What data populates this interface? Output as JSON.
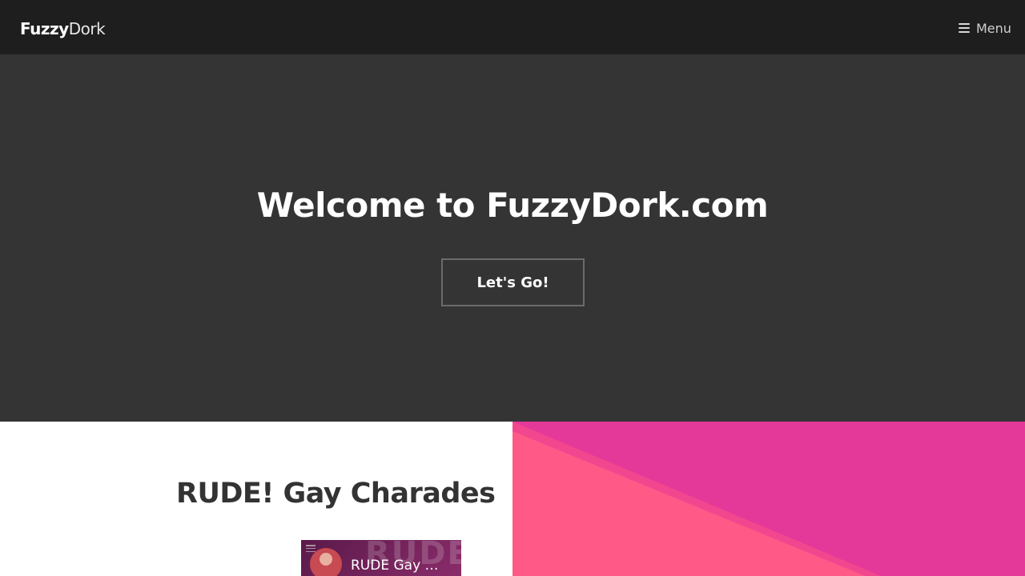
{
  "header": {
    "logo_bold": "Fuzzy",
    "logo_light": "Dork",
    "menu_label": "Menu"
  },
  "hero": {
    "title": "Welcome to FuzzyDork.com",
    "button_label": "Let's Go!"
  },
  "post": {
    "title": "RUDE! Gay Charades",
    "video_title": "RUDE Gay Ch..."
  },
  "colors": {
    "topbar": "#1e1e1e",
    "hero_bg": "#343434",
    "accent_pink": "#e5399a",
    "accent_coral": "#ff5a87"
  },
  "icons": {
    "menu": "hamburger-icon"
  }
}
